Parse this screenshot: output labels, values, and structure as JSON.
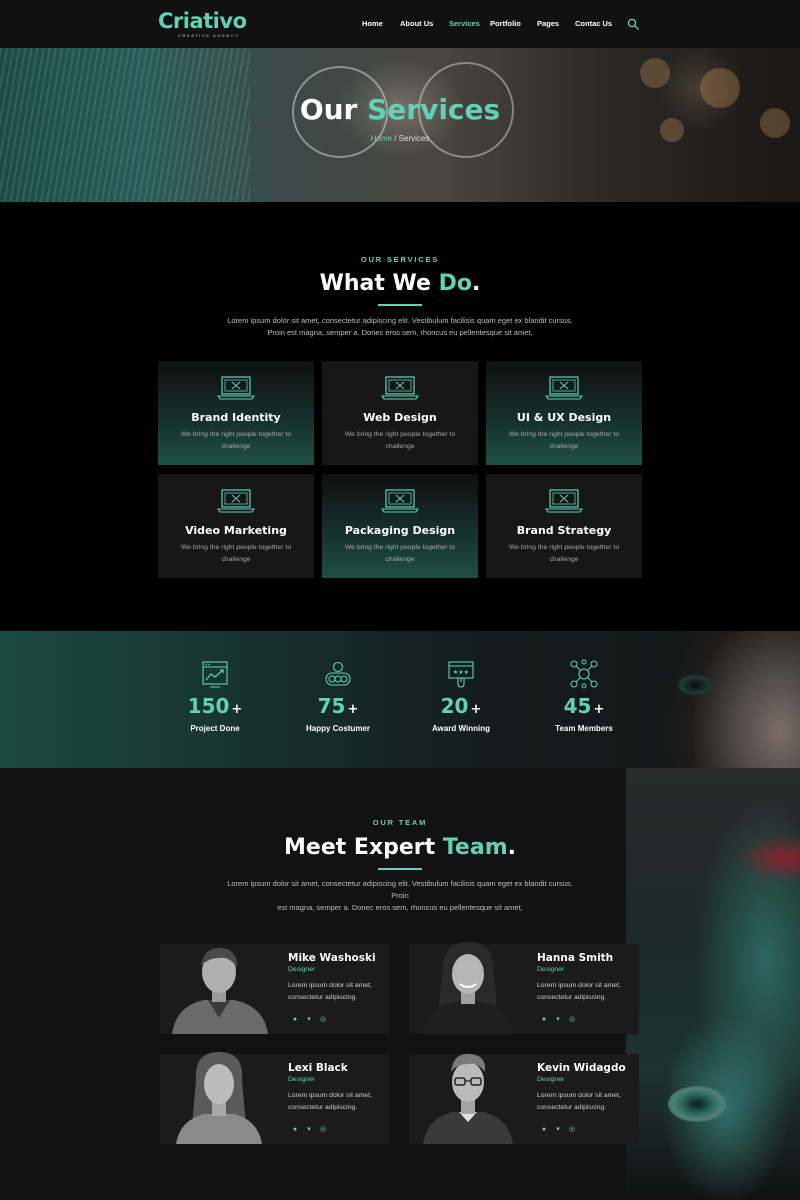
{
  "brand": {
    "name": "Criativo",
    "tagline": "CREATIVE AGENCY"
  },
  "nav": {
    "items": [
      {
        "label": "Home",
        "active": false
      },
      {
        "label": "About Us",
        "active": false
      },
      {
        "label": "Services",
        "active": true
      },
      {
        "label": "Portfolio",
        "active": false
      },
      {
        "label": "Pages",
        "active": false
      },
      {
        "label": "Contac Us",
        "active": false
      }
    ],
    "search_icon": "search-icon"
  },
  "hero": {
    "title_plain": "Our",
    "title_accent": "Services",
    "breadcrumb_home": "Home",
    "breadcrumb_separator": " / ",
    "breadcrumb_current": "Services"
  },
  "services": {
    "eyebrow": "OUR SERVICES",
    "title_plain": "What We",
    "title_accent": "Do",
    "title_dot": ".",
    "lead_line1": "Lorem ipsum dolor sit amet, consectetur adipiscing elit. Vestibulum facilisis quam eget ex blandit cursus.",
    "lead_line2": "Proin est magna, semper a. Donec eros sem, rhoncus eu pellentesque sit amet,",
    "cards": [
      {
        "title": "Brand Identity",
        "desc_line1": "We bring the right people together to",
        "desc_line2": "challenge",
        "icon": "laptop-icon"
      },
      {
        "title": "Web Design",
        "desc_line1": "We bring the right people together to",
        "desc_line2": "challenge",
        "icon": "laptop-icon"
      },
      {
        "title": "UI & UX Design",
        "desc_line1": "We bring the right people together to",
        "desc_line2": "challenge",
        "icon": "laptop-icon"
      },
      {
        "title": "Video Marketing",
        "desc_line1": "We bring the right people together to",
        "desc_line2": "challenge",
        "icon": "laptop-icon"
      },
      {
        "title": "Packaging Design",
        "desc_line1": "We bring the right people together to",
        "desc_line2": "challenge",
        "icon": "laptop-icon"
      },
      {
        "title": "Brand Strategy",
        "desc_line1": "We bring the right people together to",
        "desc_line2": "challenge",
        "icon": "laptop-icon"
      }
    ]
  },
  "stats": [
    {
      "value": "150",
      "suffix": "+",
      "label": "Project Done",
      "icon": "dashboard-chart-icon"
    },
    {
      "value": "75",
      "suffix": "+",
      "label": "Happy Costumer",
      "icon": "happy-customer-icon"
    },
    {
      "value": "20",
      "suffix": "+",
      "label": "Award Winning",
      "icon": "award-icon"
    },
    {
      "value": "45",
      "suffix": "+",
      "label": "Team Members",
      "icon": "team-network-icon"
    }
  ],
  "team": {
    "eyebrow": "OUR TEAM",
    "title_plain": "Meet Expert",
    "title_accent": "Team",
    "title_dot": ".",
    "lead_line1": "Lorem ipsum dolor sit amet, consectetur adipiscing elit. Vestibulum facilisis quam eget ex blandit cursus. Proin",
    "lead_line2": "est magna, semper a. Donec eros sem, rhoncus eu pellentesque sit amet,",
    "members": [
      {
        "name": "Mike Washoski",
        "role": "Designer",
        "bio_line1": "Lorem ipsum dolor sit amet,",
        "bio_line2": "consectetur adipiscing."
      },
      {
        "name": "Hanna Smith",
        "role": "Designer",
        "bio_line1": "Lorem ipsum dolor sit amet,",
        "bio_line2": "consectetur adipiscing."
      },
      {
        "name": "Lexi Black",
        "role": "Designer",
        "bio_line1": "Lorem ipsum dolor sit amet,",
        "bio_line2": "consectetur adipiscing."
      },
      {
        "name": "Kevin Widagdo",
        "role": "Designer",
        "bio_line1": "Lorem ipsum dolor sit amet,",
        "bio_line2": "consectetur adipiscing."
      }
    ],
    "social_icons": [
      "facebook-icon",
      "twitter-icon",
      "instagram-icon"
    ]
  },
  "colors": {
    "accent": "#5fd3b3",
    "background": "#000000",
    "card": "#171717"
  }
}
